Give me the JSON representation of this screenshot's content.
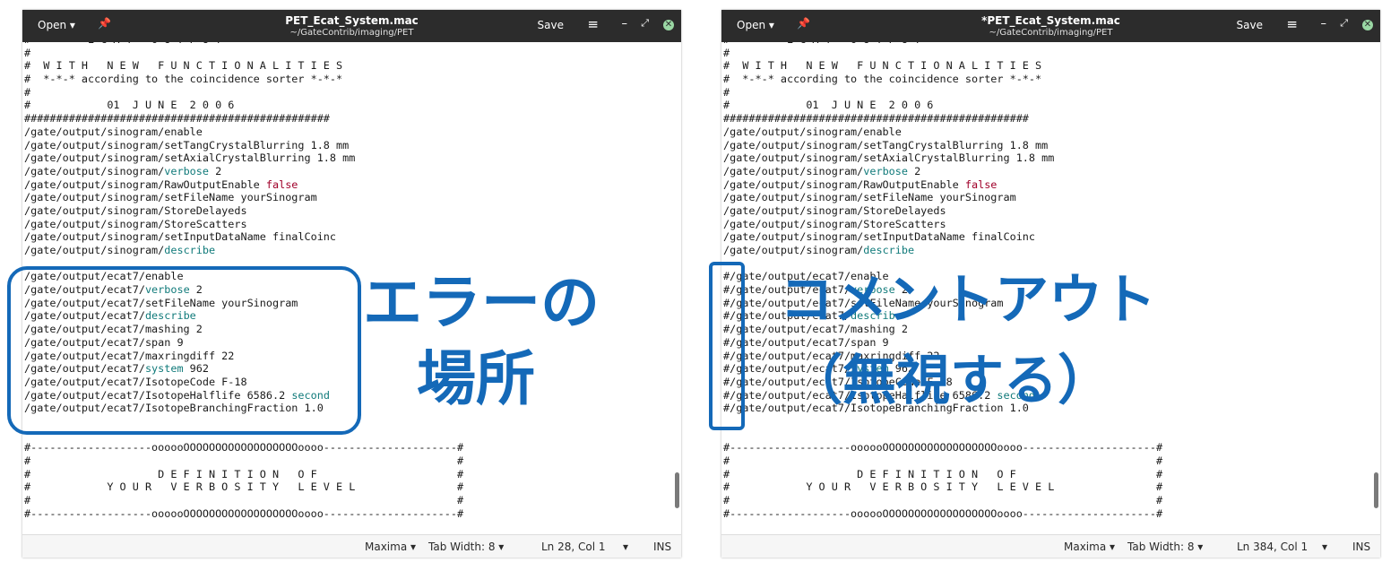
{
  "left": {
    "header": {
      "open_label": "Open ▾",
      "pin_icon": "📌",
      "title": "PET_Ecat_System.mac",
      "subtitle": "~/GateContrib/imaging/PET",
      "save_label": "Save",
      "menu_icon": "≡",
      "minimize_icon": "–",
      "maximize_icon": "⤢",
      "close_icon": "✕"
    },
    "status": {
      "language": "Maxima ▾",
      "tab_width": "Tab Width: 8 ▾",
      "position": "Ln 28, Col 1",
      "mode_dropdown": "▾",
      "insert_mode": "INS"
    },
    "overlay": {
      "line1": "エラーの",
      "line2": "場所"
    }
  },
  "right": {
    "header": {
      "open_label": "Open ▾",
      "pin_icon": "📌",
      "title": "*PET_Ecat_System.mac",
      "subtitle": "~/GateContrib/imaging/PET",
      "save_label": "Save",
      "menu_icon": "≡",
      "minimize_icon": "–",
      "maximize_icon": "⤢",
      "close_icon": "✕"
    },
    "status": {
      "language": "Maxima ▾",
      "tab_width": "Tab Width: 8 ▾",
      "position": "Ln 384, Col 1",
      "mode_dropdown": "▾",
      "insert_mode": "INS"
    },
    "overlay": {
      "line1": "コメントアウト",
      "line2": "（無視する）"
    }
  },
  "code_lines_common": [
    "#         E C A T   O U T P U T",
    "#",
    "#  W I T H   N E W   F U N C T I O N A L I T I E S",
    "#  *-*-* according to the coincidence sorter *-*-*",
    "#",
    "#            01  J U N E  2 0 0 6",
    "################################################",
    "/gate/output/sinogram/enable",
    "/gate/output/sinogram/setTangCrystalBlurring 1.8 mm",
    "/gate/output/sinogram/setAxialCrystalBlurring 1.8 mm",
    "/gate/output/sinogram/verbose 2",
    "/gate/output/sinogram/RawOutputEnable false",
    "/gate/output/sinogram/setFileName yourSinogram",
    "/gate/output/sinogram/StoreDelayeds",
    "/gate/output/sinogram/StoreScatters",
    "/gate/output/sinogram/setInputDataName finalCoinc",
    "/gate/output/sinogram/describe",
    ""
  ],
  "ecat_left": [
    "/gate/output/ecat7/enable",
    "/gate/output/ecat7/verbose 2",
    "/gate/output/ecat7/setFileName yourSinogram",
    "/gate/output/ecat7/describe",
    "/gate/output/ecat7/mashing 2",
    "/gate/output/ecat7/span 9",
    "/gate/output/ecat7/maxringdiff 22",
    "/gate/output/ecat7/system 962",
    "/gate/output/ecat7/IsotopeCode F-18",
    "/gate/output/ecat7/IsotopeHalflife 6586.2 second",
    "/gate/output/ecat7/IsotopeBranchingFraction 1.0"
  ],
  "ecat_right": [
    "#/gate/output/ecat7/enable",
    "#/gate/output/ecat7/verbose 2",
    "#/gate/output/ecat7/setFileName yourSinogram",
    "#/gate/output/ecat7/describe",
    "#/gate/output/ecat7/mashing 2",
    "#/gate/output/ecat7/span 9",
    "#/gate/output/ecat7/maxringdiff 22",
    "#/gate/output/ecat7/system 962",
    "#/gate/output/ecat7/IsotopeCode F-18",
    "#/gate/output/ecat7/IsotopeHalflife 6586.2 second",
    "#/gate/output/ecat7/IsotopeBranchingFraction 1.0"
  ],
  "code_lines_tail": [
    "",
    "",
    "#-------------------oooooOOOOOOOOOOOOOOOOOOoooo---------------------#",
    "#                                                                   #",
    "#                    D E F I N I T I O N   O F                      #",
    "#            Y O U R   V E R B O S I T Y   L E V E L                #",
    "#                                                                   #",
    "#-------------------oooooOOOOOOOOOOOOOOOOOOoooo---------------------#"
  ],
  "colors": {
    "header_bg": "#2c2c2c",
    "keyword": "#107a7a",
    "literal": "#a0002a",
    "annotation": "#1469b8"
  }
}
